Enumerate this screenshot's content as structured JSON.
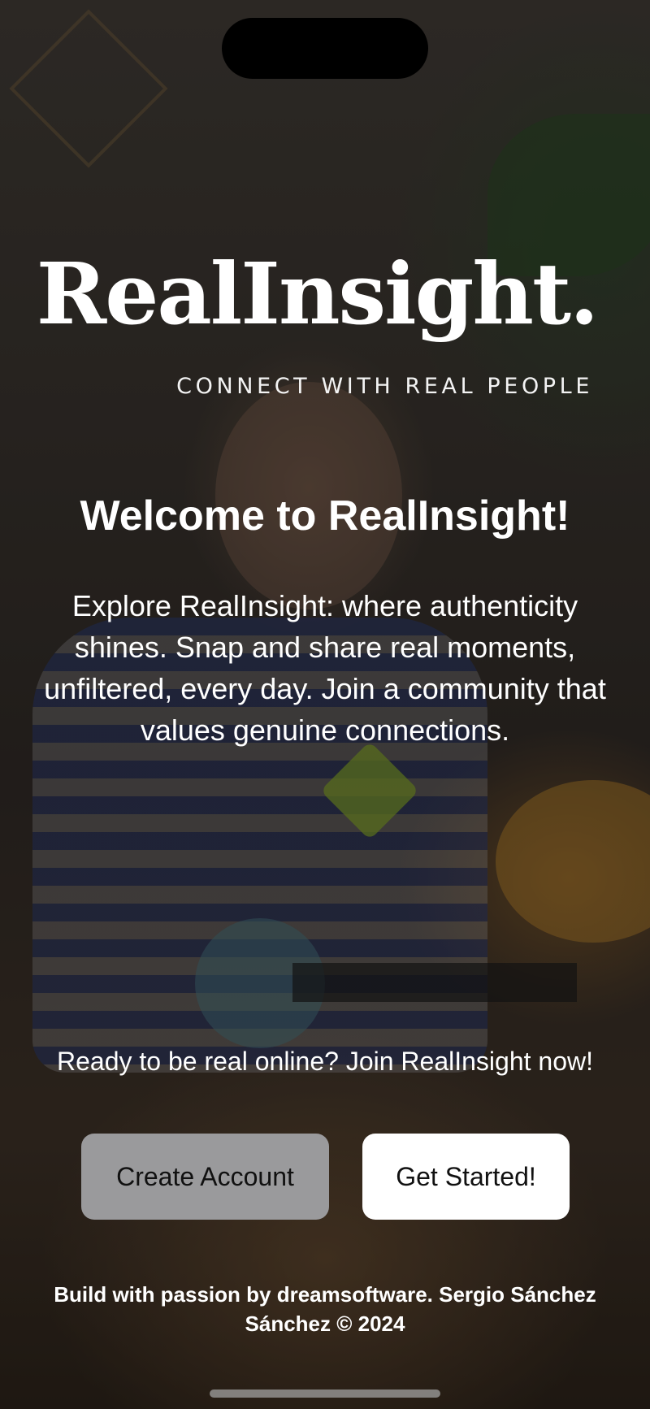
{
  "logo": {
    "wordmark": "RealInsight.",
    "tagline": "CONNECT WITH REAL PEOPLE"
  },
  "welcome": {
    "title": "Welcome to RealInsight!",
    "intro": "Explore RealInsight: where authenticity shines. Snap and share real moments, unfiltered, every day. Join a community that values genuine connections."
  },
  "cta": {
    "text": "Ready to be real online? Join RealInsight now!",
    "create_account_label": "Create Account",
    "get_started_label": "Get Started!"
  },
  "footer": {
    "credit": "Build with passion by dreamsoftware. Sergio Sánchez Sánchez © 2024"
  },
  "colors": {
    "create_button_bg": "#9a9a9c",
    "get_started_bg": "#ffffff",
    "text": "#ffffff"
  }
}
